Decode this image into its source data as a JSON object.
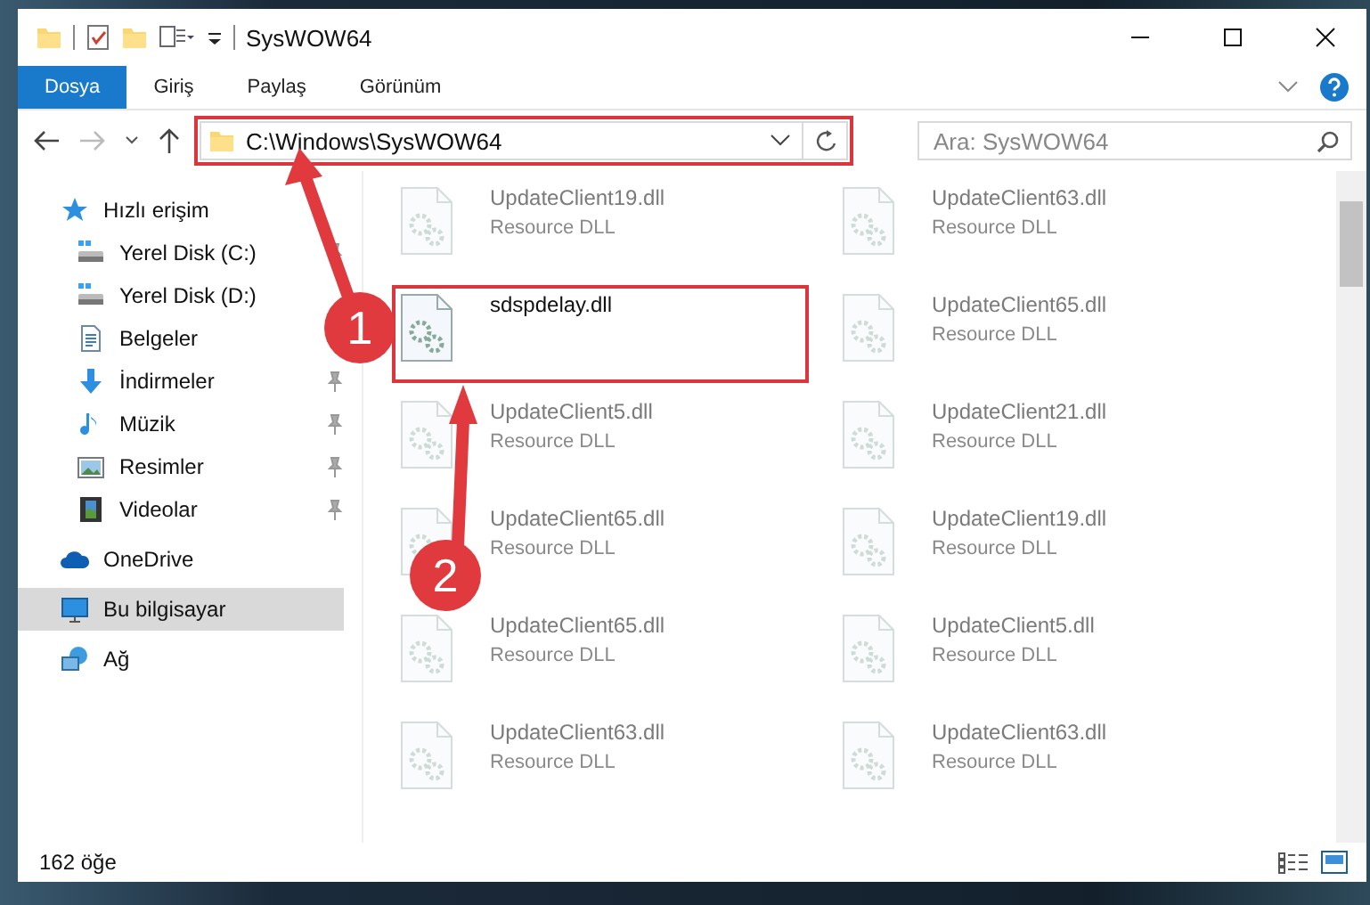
{
  "window": {
    "title": "SysWOW64"
  },
  "ribbon_tabs": [
    {
      "label": "Dosya",
      "selected": true
    },
    {
      "label": "Giriş",
      "selected": false
    },
    {
      "label": "Paylaş",
      "selected": false
    },
    {
      "label": "Görünüm",
      "selected": false
    }
  ],
  "address": {
    "path": "C:\\Windows\\SysWOW64",
    "highlighted": true
  },
  "search": {
    "placeholder": "Ara: SysWOW64"
  },
  "sidebar": {
    "items": [
      {
        "label": "Hızlı erişim",
        "selected": false,
        "children": [
          {
            "label": "Yerel Disk (C:)",
            "pinned": true,
            "selected": false
          },
          {
            "label": "Yerel Disk (D:)",
            "selected": false
          },
          {
            "label": "Belgeler",
            "selected": false
          },
          {
            "label": "İndirmeler",
            "pinned": true,
            "selected": false
          },
          {
            "label": "Müzik",
            "pinned": true,
            "selected": false
          },
          {
            "label": "Resimler",
            "pinned": true,
            "selected": false
          },
          {
            "label": "Videolar",
            "pinned": true,
            "selected": false
          }
        ]
      },
      {
        "label": "OneDrive",
        "selected": false
      },
      {
        "label": "Bu bilgisayar",
        "selected": true
      },
      {
        "label": "Ağ",
        "selected": false
      }
    ]
  },
  "files": [
    {
      "name": "UpdateClient19.dll",
      "type": "Resource DLL",
      "faded": true,
      "highlighted": false
    },
    {
      "name": "UpdateClient63.dll",
      "type": "Resource DLL",
      "faded": true,
      "highlighted": false
    },
    {
      "name": "sdspdelay.dll",
      "faded": false,
      "highlighted": true
    },
    {
      "name": "UpdateClient65.dll",
      "type": "Resource DLL",
      "faded": true,
      "highlighted": false
    },
    {
      "name": "UpdateClient5.dll",
      "type": "Resource DLL",
      "faded": true,
      "highlighted": false
    },
    {
      "name": "UpdateClient21.dll",
      "type": "Resource DLL",
      "faded": true,
      "highlighted": false
    },
    {
      "name": "UpdateClient65.dll",
      "type": "Resource DLL",
      "faded": true,
      "highlighted": false
    },
    {
      "name": "UpdateClient19.dll",
      "type": "Resource DLL",
      "faded": true,
      "highlighted": false
    },
    {
      "name": "UpdateClient65.dll",
      "type": "Resource DLL",
      "faded": true,
      "highlighted": false
    },
    {
      "name": "UpdateClient5.dll",
      "type": "Resource DLL",
      "faded": true,
      "highlighted": false
    },
    {
      "name": "UpdateClient63.dll",
      "type": "Resource DLL",
      "faded": true,
      "highlighted": false
    },
    {
      "name": "UpdateClient63.dll",
      "type": "Resource DLL",
      "faded": true,
      "highlighted": false
    }
  ],
  "steps": [
    {
      "number": "1"
    },
    {
      "number": "2"
    }
  ],
  "status_bar": {
    "count": "162 öğe"
  }
}
